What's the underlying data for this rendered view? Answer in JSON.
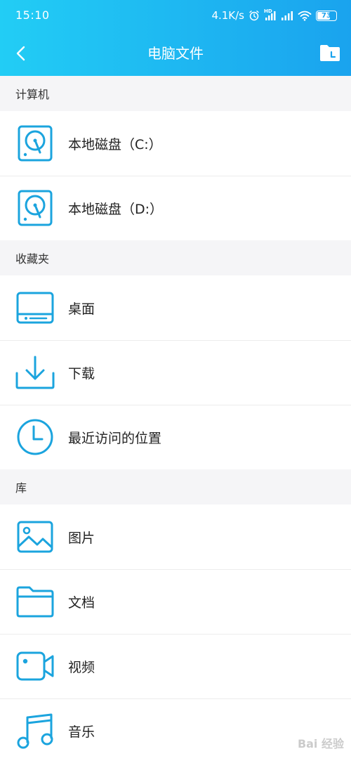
{
  "status_bar": {
    "time": "15:10",
    "net_speed": "4.1K/s",
    "hd_badge": "HD",
    "battery_level": "73",
    "icons": [
      "alarm-icon",
      "signal-hd-icon",
      "signal-icon",
      "wifi-icon",
      "battery-icon"
    ]
  },
  "header": {
    "title": "电脑文件",
    "back_icon": "chevron-left-icon",
    "action_icon": "folder-icon",
    "gradient_start": "#22cdf5",
    "gradient_end": "#1aa3ee"
  },
  "accent_color": "#1ba4de",
  "sections": [
    {
      "title": "计算机",
      "items": [
        {
          "label": "本地磁盘（C:）",
          "icon": "hard-disk-icon"
        },
        {
          "label": "本地磁盘（D:）",
          "icon": "hard-disk-icon"
        }
      ]
    },
    {
      "title": "收藏夹",
      "items": [
        {
          "label": "桌面",
          "icon": "desktop-icon"
        },
        {
          "label": "下载",
          "icon": "download-icon"
        },
        {
          "label": "最近访问的位置",
          "icon": "clock-icon"
        }
      ]
    },
    {
      "title": "库",
      "items": [
        {
          "label": "图片",
          "icon": "image-icon"
        },
        {
          "label": "文档",
          "icon": "folder-icon"
        },
        {
          "label": "视频",
          "icon": "video-icon"
        },
        {
          "label": "音乐",
          "icon": "music-icon"
        }
      ]
    }
  ],
  "watermark": "Bai 经验"
}
